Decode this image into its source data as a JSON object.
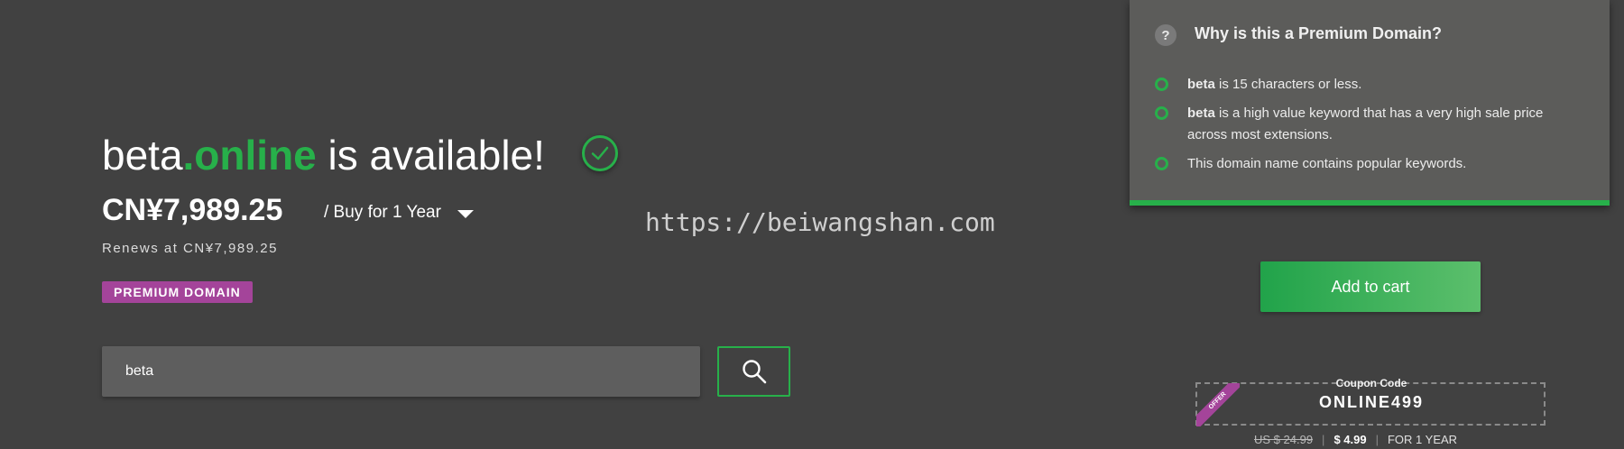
{
  "headline": {
    "sld": "beta",
    "tld": ".online",
    "rest": " is available!"
  },
  "price": {
    "amount": "CN¥7,989.25",
    "period": "/ Buy for 1 Year",
    "renews": "Renews at CN¥7,989.25"
  },
  "badge": "PREMIUM DOMAIN",
  "search": {
    "value": "beta"
  },
  "watermark": "https://beiwangshan.com",
  "premium_panel": {
    "question_mark": "?",
    "title": "Why is this a Premium Domain?",
    "reasons": [
      {
        "bold": "beta",
        "text": " is 15 characters or less."
      },
      {
        "bold": "beta",
        "text": " is a high value keyword that has a very high sale price across most extensions."
      },
      {
        "bold": "",
        "text": "This domain name contains popular keywords."
      }
    ]
  },
  "cart_button": "Add to cart",
  "coupon": {
    "label": "Coupon Code",
    "code": "ONLINE499",
    "ribbon": "OFFER",
    "old_price": "US $ 24.99",
    "new_price": "$ 4.99",
    "term": "FOR 1 YEAR",
    "separator": "|"
  },
  "colors": {
    "background": "#414141",
    "accent_green": "#27b04a",
    "premium_purple": "#a4449a"
  }
}
